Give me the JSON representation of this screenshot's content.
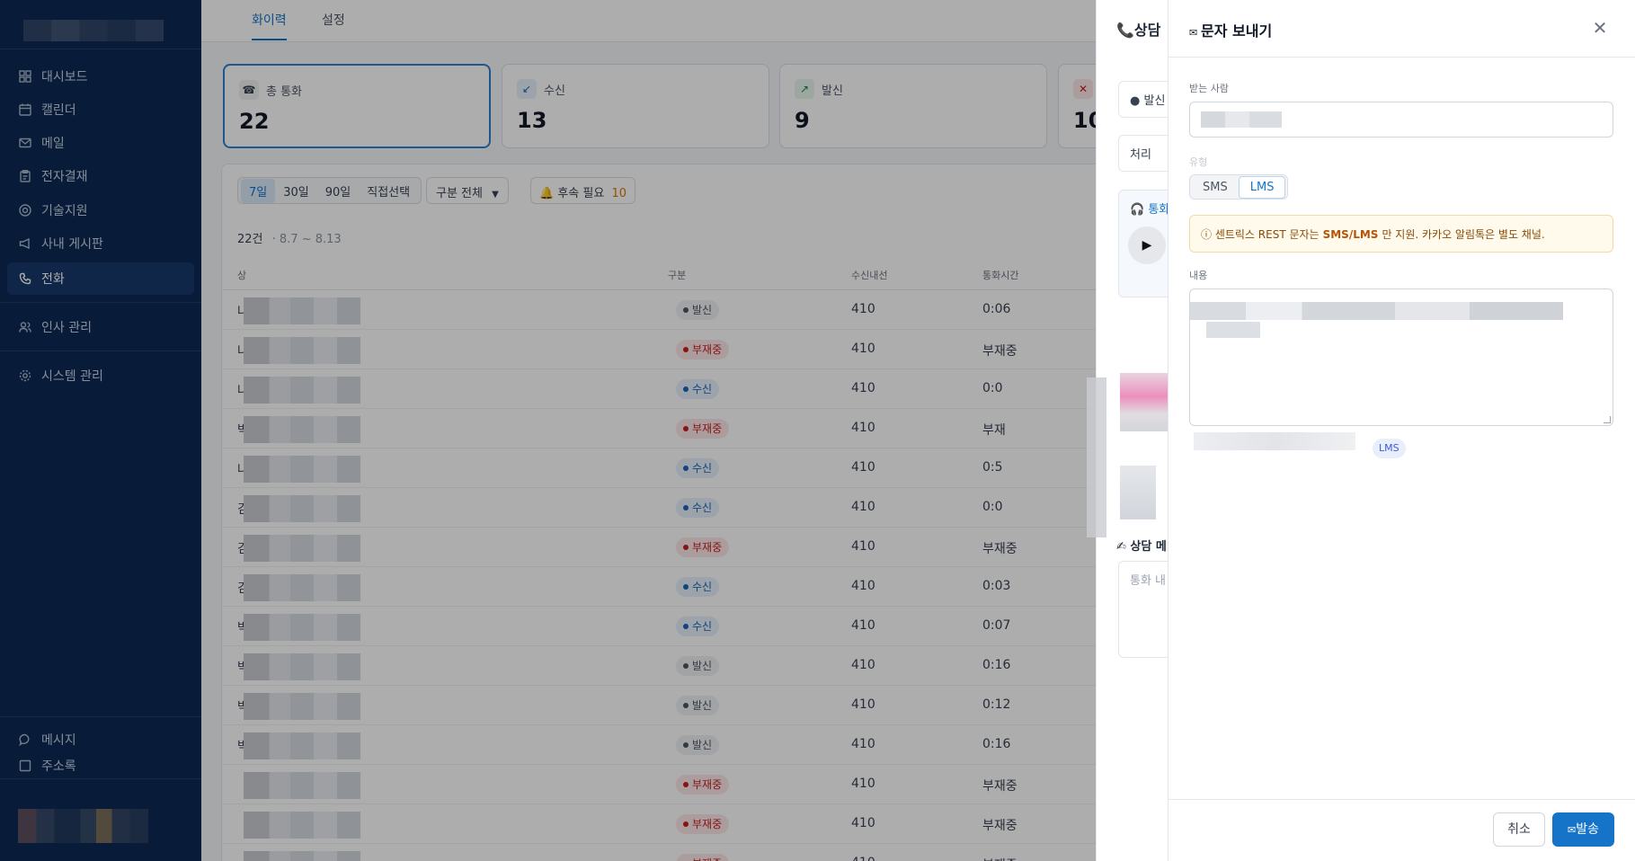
{
  "sidebar": {
    "items": [
      {
        "label": "대시보드",
        "icon": "grid-icon"
      },
      {
        "label": "캘린더",
        "icon": "calendar-icon"
      },
      {
        "label": "메일",
        "icon": "mail-icon"
      },
      {
        "label": "전자결재",
        "icon": "clipboard-icon"
      },
      {
        "label": "기술지원",
        "icon": "lifebuoy-icon"
      },
      {
        "label": "사내 게시판",
        "icon": "megaphone-icon"
      },
      {
        "label": "전화",
        "icon": "phone-icon"
      },
      {
        "label": "인사 관리",
        "icon": "users-icon"
      },
      {
        "label": "시스템 관리",
        "icon": "gear-icon"
      }
    ],
    "bottom": [
      {
        "label": "메시지",
        "icon": "chat-icon"
      },
      {
        "label": "주소록",
        "icon": "contacts-icon"
      }
    ]
  },
  "tabs": [
    "화이력",
    "설정"
  ],
  "stats": [
    {
      "label": "총 통화",
      "value": "22",
      "icon": "☎"
    },
    {
      "label": "수신",
      "value": "13",
      "icon": "↙"
    },
    {
      "label": "발신",
      "value": "9",
      "icon": "↗"
    },
    {
      "label": "",
      "value": "10",
      "icon": "✕"
    }
  ],
  "filters": {
    "ranges": [
      "7일",
      "30일",
      "90일",
      "직접선택"
    ],
    "category": "구분 전체",
    "followup_label": "후속 필요",
    "followup_count": "10"
  },
  "summary": {
    "count": "22건",
    "range": "8.7 ~ 8.13"
  },
  "table": {
    "headers": [
      "상",
      "구분",
      "수신내선",
      "통화시간"
    ],
    "rows": [
      {
        "name": "나",
        "type": "발신",
        "kind": "out",
        "ext": "410",
        "dur": "0:06"
      },
      {
        "name": "나",
        "type": "부재중",
        "kind": "miss",
        "ext": "410",
        "dur": "부재중"
      },
      {
        "name": "나",
        "type": "수신",
        "kind": "in",
        "ext": "410",
        "dur": "0:0"
      },
      {
        "name": "박",
        "type": "부재중",
        "kind": "miss",
        "ext": "410",
        "dur": "부재"
      },
      {
        "name": "나",
        "type": "수신",
        "kind": "in",
        "ext": "410",
        "dur": "0:5"
      },
      {
        "name": "김",
        "type": "수신",
        "kind": "in",
        "ext": "410",
        "dur": "0:0"
      },
      {
        "name": "김",
        "type": "부재중",
        "kind": "miss",
        "ext": "410",
        "dur": "부재중"
      },
      {
        "name": "김",
        "type": "수신",
        "kind": "in",
        "ext": "410",
        "dur": "0:03"
      },
      {
        "name": "박",
        "type": "수신",
        "kind": "in",
        "ext": "410",
        "dur": "0:07"
      },
      {
        "name": "박",
        "type": "발신",
        "kind": "out",
        "ext": "410",
        "dur": "0:16"
      },
      {
        "name": "박",
        "type": "발신",
        "kind": "out",
        "ext": "410",
        "dur": "0:12"
      },
      {
        "name": "박",
        "type": "발신",
        "kind": "out",
        "ext": "410",
        "dur": "0:16"
      },
      {
        "name": "",
        "type": "부재중",
        "kind": "miss",
        "ext": "410",
        "dur": "부재중"
      },
      {
        "name": "",
        "type": "부재중",
        "kind": "miss",
        "ext": "410",
        "dur": "부재중"
      },
      {
        "name": "",
        "type": "부재중",
        "kind": "miss",
        "ext": "410",
        "dur": "부재중"
      }
    ]
  },
  "consult": {
    "title": "상담",
    "dir_label": "발신",
    "status_label": "처리",
    "recording_label": "통화",
    "memo_title": "상담 메",
    "memo_placeholder": "통화 내"
  },
  "sms": {
    "title": "문자 보내기",
    "recipient_label": "받는 사람",
    "type_label": "유형",
    "types": [
      "SMS",
      "LMS"
    ],
    "notice_prefix": "ⓘ 센트릭스 REST 문자는",
    "notice_bold": "SMS/LMS",
    "notice_suffix": "만 지원. 카카오 알림톡은 별도 채널.",
    "content_label": "내용",
    "type_badge": "LMS",
    "cancel": "취소",
    "send": "발송"
  },
  "colors": {
    "sidebar_bg": "#0c2a55",
    "accent": "#1574c8",
    "missed": "#c81e1e",
    "incoming": "#1c64b6"
  }
}
